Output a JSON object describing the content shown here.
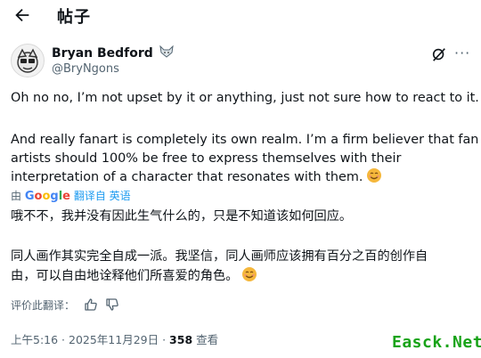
{
  "header": {
    "title": "帖子"
  },
  "author": {
    "name": "Bryan Bedford",
    "handle": "@BryNgons"
  },
  "post": {
    "para1": "Oh no no, I’m not upset by it or anything, just not sure how to react to it.",
    "para2_lines": [
      "And really fanart is completely its own realm. I’m a firm believer that fan",
      "artists should 100% be free to express themselves with their",
      "interpretation of a character that resonates with them."
    ]
  },
  "translation": {
    "by": "由",
    "brand": "Google",
    "action": "翻译自 英语"
  },
  "translated": {
    "line1": "哦不不，我并没有因此生气什么的，只是不知道该如何回应。",
    "para2_lines": [
      "同人画作其实完全自成一派。我坚信，同人画师应该拥有百分之百的创作自",
      "由，可以自由地诠释他们所喜爱的角色。"
    ]
  },
  "rating": {
    "label": "评价此翻译："
  },
  "meta": {
    "time": "上午5:16 · 2025年11月29日 · ",
    "views": "358",
    "views_label": " 查看"
  },
  "watermark": "Easck.Net",
  "icons": {
    "back": "back-arrow-icon",
    "verify_badge": "fox-icon",
    "grok": "grok-icon",
    "more": "more-icon",
    "like": "thumbs-up-icon",
    "dislike": "thumbs-down-icon",
    "emoji": "smiling-face-emoji"
  }
}
